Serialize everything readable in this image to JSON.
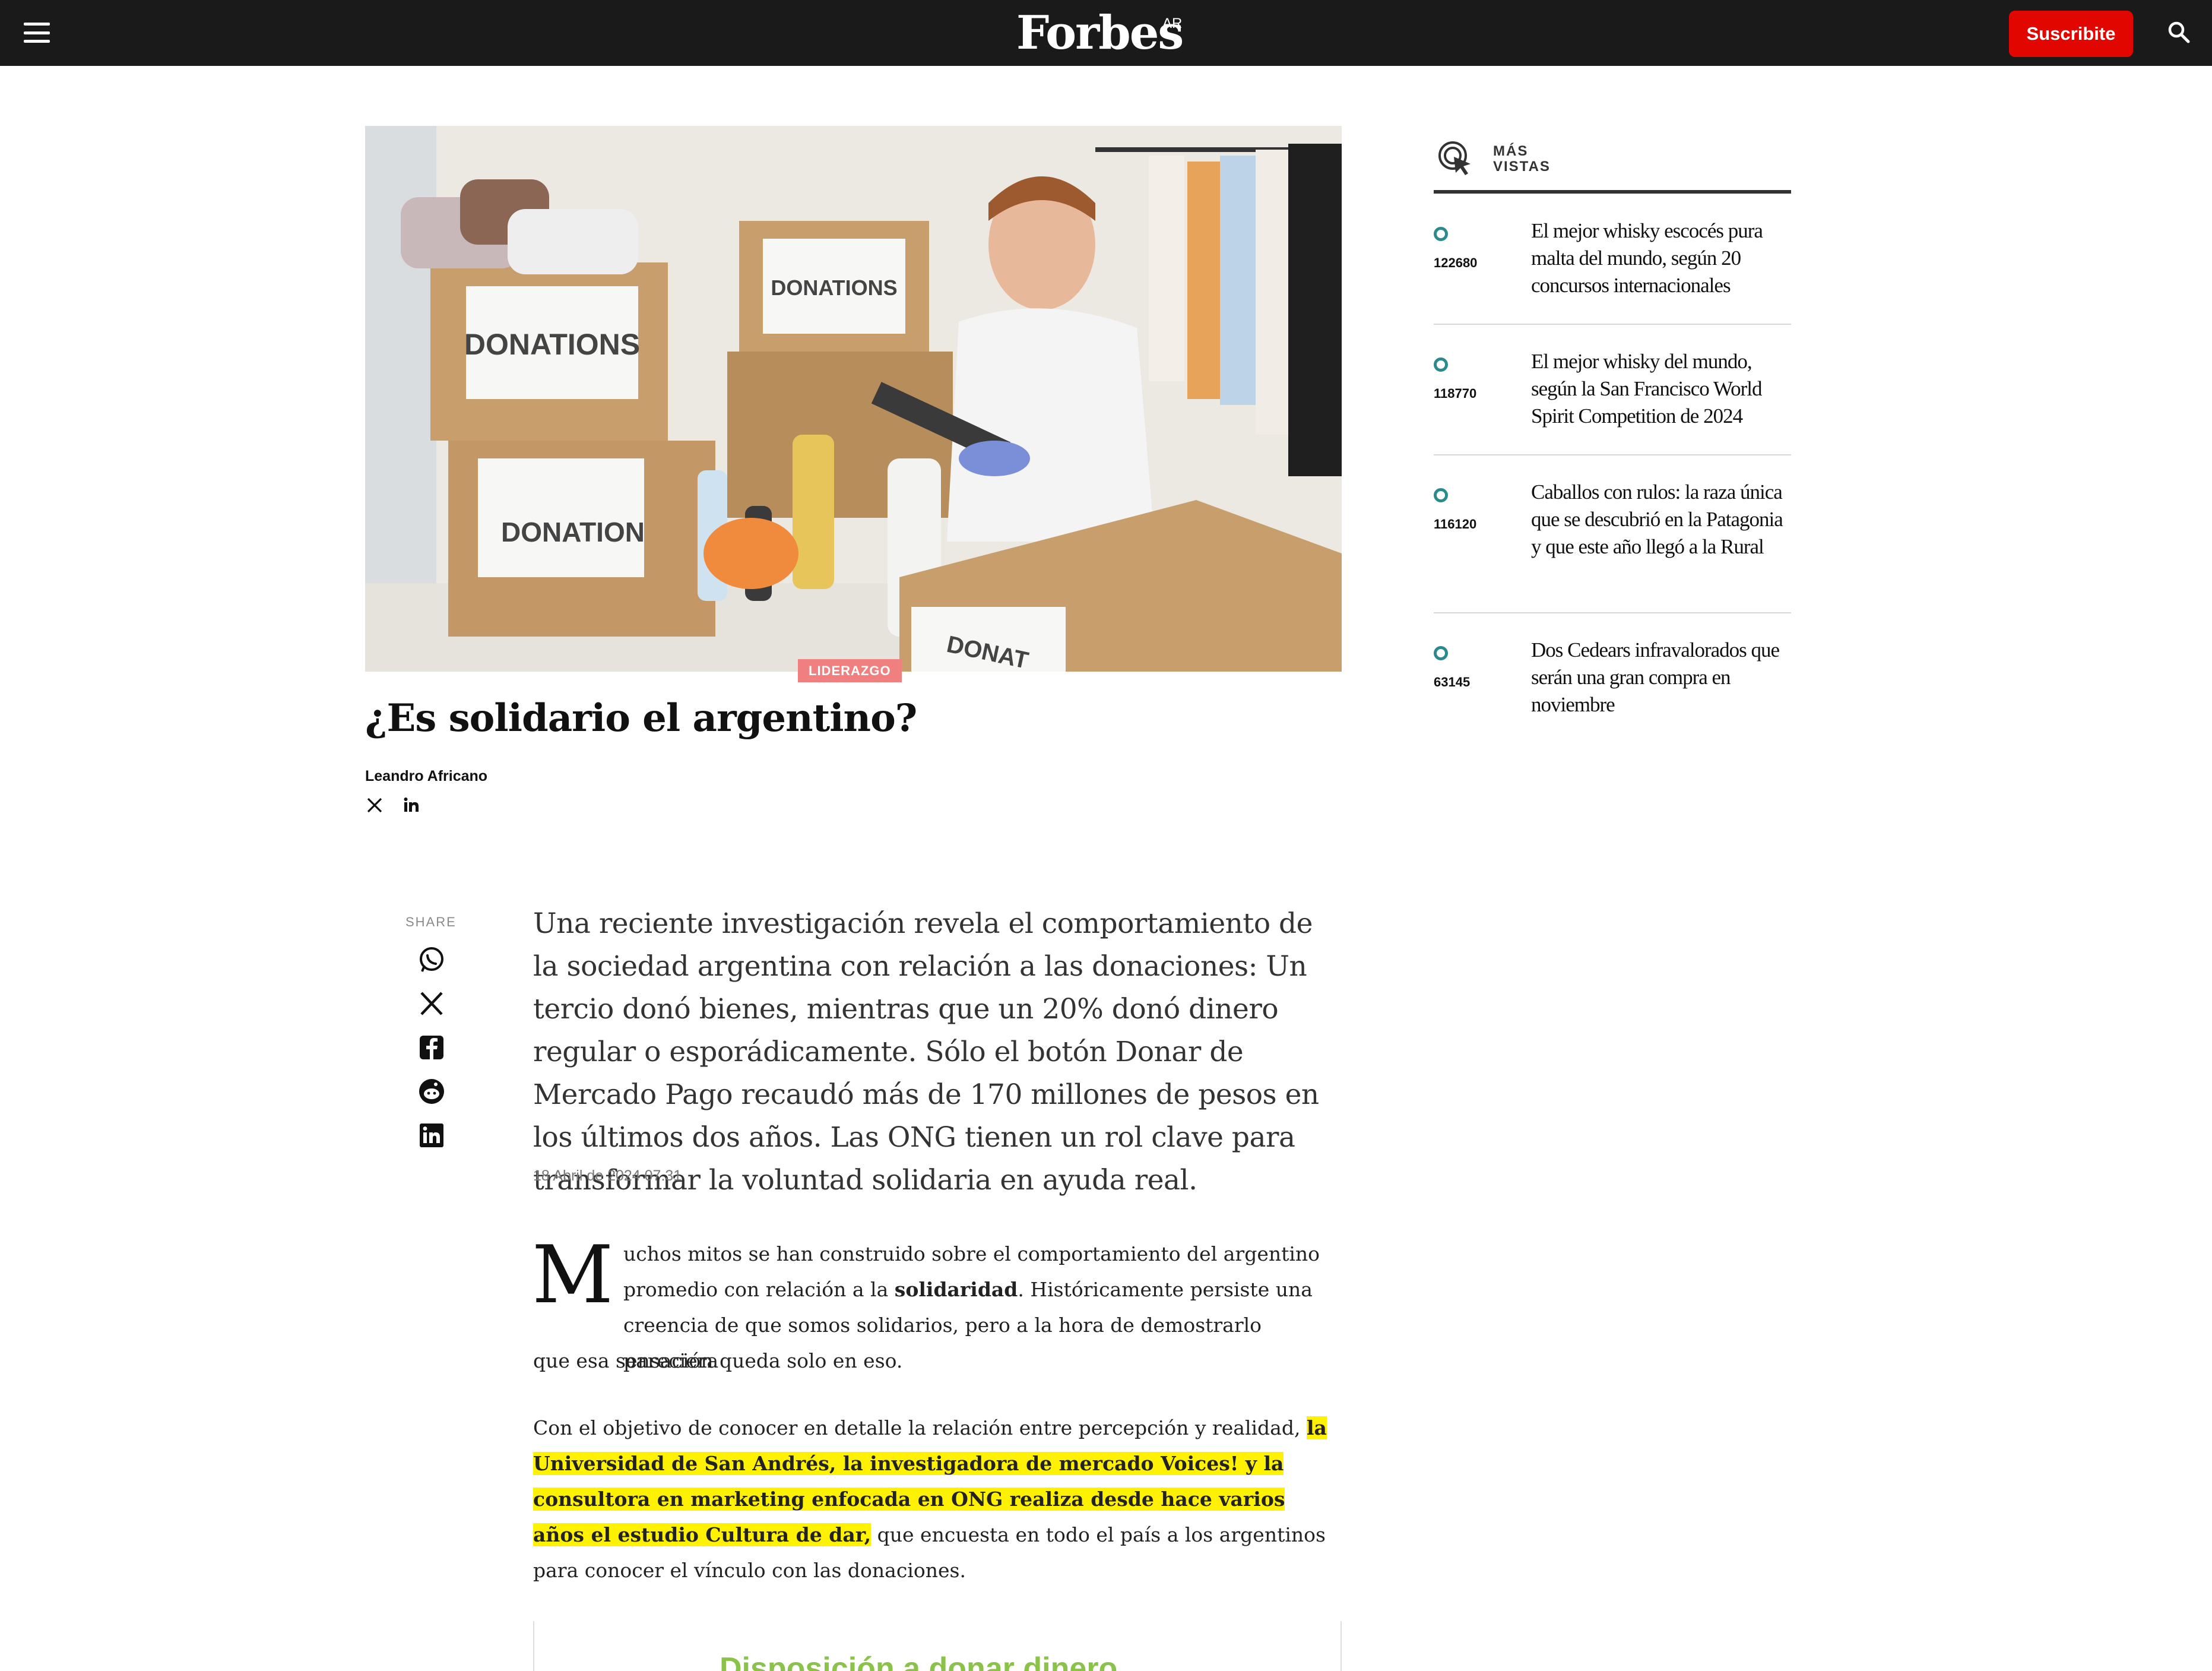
{
  "header": {
    "brand": "Forbes",
    "edition": "AR",
    "subscribe_label": "Suscribite"
  },
  "article": {
    "category": "LIDERAZGO",
    "title": "¿Es solidario el argentino?",
    "author": "Leandro Africano",
    "share_label": "SHARE",
    "lead": "Una reciente investigación revela el comportamiento de la sociedad argentina con relación a las donaciones: Un tercio donó bienes, mientras que un 20% donó dinero regular o esporádicamente. Sólo el botón Donar de Mercado Pago recaudó más de 170 millones de pesos en los últimos dos años. Las ONG tienen un rol clave para transformar la voluntad solidaria en ayuda real.",
    "date": "18 Abril de 2024 07.31",
    "dropcap": "M",
    "p1_start": "uchos mitos se han construido sobre el comportamiento del argentino promedio con relación a la ",
    "p1_bold": "solidaridad",
    "p1_after": ". Históricamente persiste una creencia de que somos solidarios, pero a la hora de demostrarlo pareciera",
    "p1_last": "que esa sensación queda solo en eso.",
    "p2_start": "Con el objetivo de conocer en detalle la relación entre percepción y realidad, ",
    "p2_highlight": "la Universidad de San Andrés, la investigadora de mercado Voices! y la consultora en marketing enfocada en ONG realiza desde hace varios años el estudio Cultura de dar,",
    "p2_end": " que encuesta en todo el país a los argentinos para conocer el vínculo con las donaciones.",
    "embed_title": "Disposición a donar dinero"
  },
  "hero_image": {
    "box_labels": [
      "DONATIONS",
      "DONATIONS",
      "DONATION",
      "DONAT"
    ]
  },
  "sidebar": {
    "label_line1": "MÁS",
    "label_line2": "VISTAS",
    "items": [
      {
        "count": "122680",
        "title": "El mejor whisky escocés pura malta del mundo, según 20 concursos internacionales"
      },
      {
        "count": "118770",
        "title": "El mejor whisky del mundo, según la San Francisco World Spirit Competition de 2024"
      },
      {
        "count": "116120",
        "title": "Caballos con rulos: la raza única que se descubrió en la Patagonia y que este año llegó a la Rural"
      },
      {
        "count": "63145",
        "title": "Dos Cedears infravalorados que serán una gran compra en noviembre"
      }
    ]
  }
}
